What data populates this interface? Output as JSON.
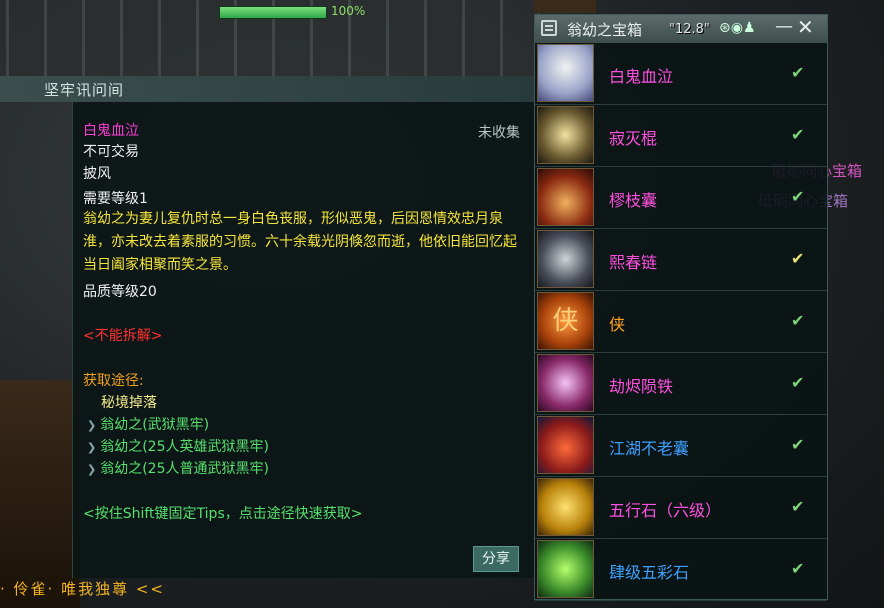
{
  "hud": {
    "hp_percent": "100%",
    "hp_fraction": 1.0
  },
  "tooltip": {
    "header": "坚牢讯问间",
    "item_name": "白鬼血泣",
    "status": "未收集",
    "lines": [
      "不可交易",
      "披风",
      "需要等级1"
    ],
    "description": "翁幼之为妻儿复仇时总一身白色丧服，形似恶鬼，后因恩情效忠月泉淮，亦未改去着素服的习惯。六十余载光阴倏忽而逝，他依旧能回忆起当日阖家相聚而笑之景。",
    "quality": "品质等级20",
    "cannot_disassemble": "<不能拆解>",
    "source_title": "获取途径:",
    "source_type": "秘境掉落",
    "sources": [
      "翁幼之(武狱黑牢)",
      "翁幼之(25人英雄武狱黑牢)",
      "翁幼之(25人普通武狱黑牢)"
    ],
    "tip": "<按住Shift键固定Tips，点击途径快速获取>",
    "share_label": "分享"
  },
  "chat": {
    "line": "· 伶雀· 唯我独尊 <<"
  },
  "background_labels": [
    "砥砺同心宝箱",
    "砥砺同心宝箱"
  ],
  "chest": {
    "title": "翁幼之宝箱",
    "fps": "\"12.8\"",
    "items": [
      {
        "name": "白鬼血泣",
        "color": "#ff50e0",
        "check": "gold-dim",
        "icon": "ghost-cloak-icon"
      },
      {
        "name": "寂灭棍",
        "color": "#ff50e0",
        "check": "green",
        "icon": "staff-icon"
      },
      {
        "name": "樛枝囊",
        "color": "#ff50e0",
        "check": "green",
        "icon": "pouch-icon"
      },
      {
        "name": "熙春链",
        "color": "#ff50e0",
        "check": "gold",
        "icon": "chain-icon"
      },
      {
        "name": "侠",
        "color": "#ffa020",
        "check": "green",
        "icon": "xia-emblem-icon"
      },
      {
        "name": "劫烬陨铁",
        "color": "#ff50e0",
        "check": "green",
        "icon": "meteor-iron-icon"
      },
      {
        "name": "江湖不老囊",
        "color": "#3ea0ff",
        "check": "green",
        "icon": "red-bag-icon"
      },
      {
        "name": "五行石（六级）",
        "color": "#ff50e0",
        "check": "green",
        "icon": "five-element-stone-icon"
      },
      {
        "name": "肆级五彩石",
        "color": "#3ea0ff",
        "check": "green",
        "icon": "colorful-stone-icon"
      }
    ]
  }
}
